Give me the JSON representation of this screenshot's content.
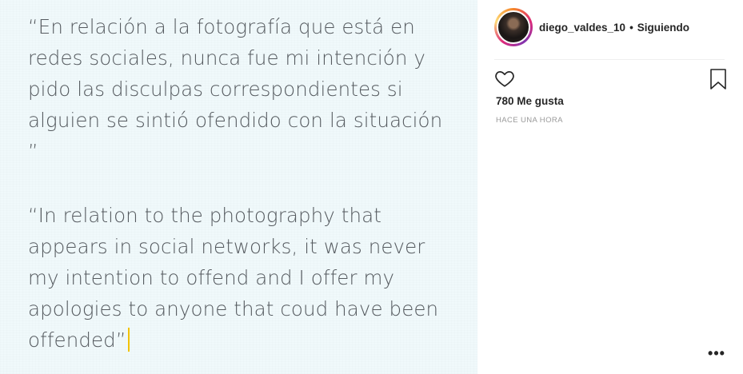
{
  "post_image": {
    "quote_es": "“En relación a la fotografía que está en\nredes sociales, nunca fue mi intención y\npido las disculpas correspondientes si\nalguien se sintió ofendido con la situación\n”",
    "quote_en": "“In relation to the photography that\nappears in social networks, it was never\nmy intention to offend and I offer my\napologies to anyone that coud have been\noffended”"
  },
  "header": {
    "username": "diego_valdes_10",
    "separator": "•",
    "follow_status": "Siguiendo"
  },
  "actions": {
    "like_icon": "heart-icon",
    "save_icon": "bookmark-icon"
  },
  "likes": "780 Me gusta",
  "timestamp": "HACE UNA HORA",
  "more_icon": "more-options-icon",
  "colors": {
    "image_background": "#f0f9fb",
    "quote_text": "#555a5f",
    "cursor": "#f2c200",
    "primary_text": "#262626",
    "secondary_text": "#999999"
  }
}
